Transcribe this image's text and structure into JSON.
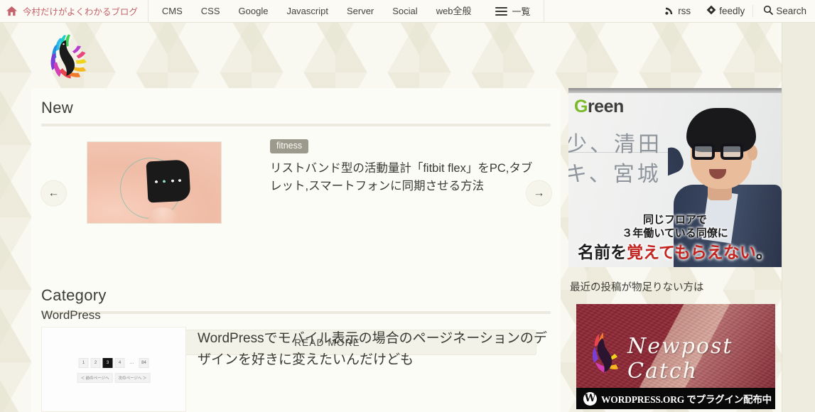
{
  "topnav": {
    "brand": {
      "label": "今村だけがよくわかるブログ",
      "icon": "home-icon"
    },
    "links": [
      "CMS",
      "CSS",
      "Google",
      "Javascript",
      "Server",
      "Social",
      "web全般"
    ],
    "list_label": "一覧",
    "right": [
      {
        "label": "rss",
        "icon": "rss-icon"
      },
      {
        "label": "feedly",
        "icon": "feedly-icon"
      },
      {
        "label": "Search",
        "icon": "search-icon"
      }
    ]
  },
  "logo": {
    "alt": "rainbow-phoenix-logo"
  },
  "main": {
    "new": {
      "heading": "New",
      "prev_arrow": "←",
      "next_arrow": "→",
      "slide": {
        "tag": "fitness",
        "title": "リストバンド型の活動量計「fitbit flex」をPC,タブレット,スマートフォンに同期させる方法",
        "thumb_alt": "fitbit-flex-wristband-photo"
      },
      "read_more": "READ MORE"
    },
    "category": {
      "heading": "Category",
      "name": "WordPress",
      "post": {
        "title": "WordPressでモバイル表示の場合のページネーションのデザインを好きに変えたいんだけども",
        "thumb": {
          "pages": [
            "1",
            "2",
            "3",
            "4",
            "…",
            "84"
          ],
          "current_page": "3",
          "prev_label": "＜ 前のページへ",
          "next_label": "次のページへ ＞"
        }
      }
    }
  },
  "sidebar": {
    "ad_green": {
      "logo_g": "G",
      "logo_rest": "reen",
      "board_line1": "少、清田",
      "board_line2": "キ、宮城",
      "copy_line1": "同じフロアで",
      "copy_line2": "３年働いている同僚に",
      "copy_line3_a": "名前を",
      "copy_line3_b": "覚えてもらえない",
      "copy_line3_c": "。"
    },
    "note": "最近の投稿が物足りない方は",
    "ad_newpost": {
      "title": "Newpost Catch",
      "strip_mark": "W",
      "strip_text": "WORDPRESS.ORG でプラグイン配布中"
    }
  },
  "colors": {
    "brand_red": "#c4636b",
    "page_bg": "#f7f6ed",
    "card_bg": "#fcfcf7",
    "rule": "#eceade",
    "tag_bg": "#9b9a8c",
    "green_accent": "#7ab929",
    "ad_red": "#c2241f"
  }
}
